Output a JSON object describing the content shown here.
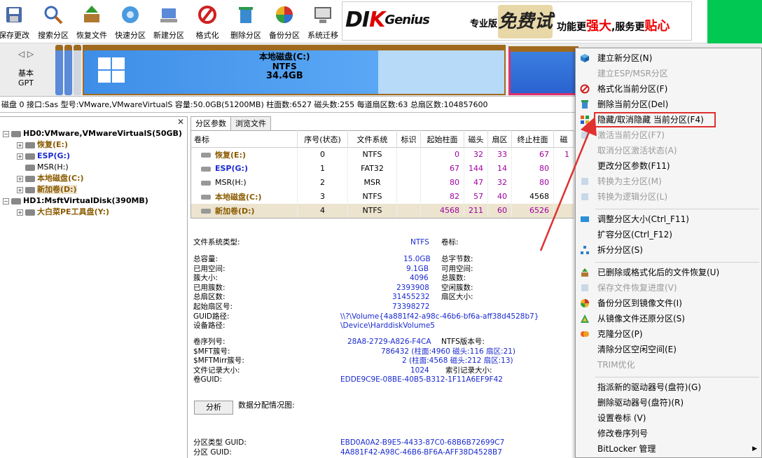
{
  "toolbar": {
    "buttons": [
      {
        "label": "保存更改",
        "icon": "save-icon"
      },
      {
        "label": "搜索分区",
        "icon": "search-icon"
      },
      {
        "label": "恢复文件",
        "icon": "recover-icon"
      },
      {
        "label": "快速分区",
        "icon": "quick-partition-icon"
      },
      {
        "label": "新建分区",
        "icon": "new-partition-icon"
      },
      {
        "label": "格式化",
        "icon": "format-icon"
      },
      {
        "label": "删除分区",
        "icon": "delete-icon"
      },
      {
        "label": "备份分区",
        "icon": "backup-icon"
      },
      {
        "label": "系统迁移",
        "icon": "migrate-icon"
      }
    ]
  },
  "banner": {
    "logo_a": "DI",
    "logo_b": "K",
    "logo_c": "Genius",
    "edition": "专业版",
    "free": "免费试用",
    "slogan_a": "功能更",
    "slogan_b": "强大",
    "slogan_c": ",服务更",
    "slogan_d": "贴心"
  },
  "disk_nav": {
    "type1": "基本",
    "type2": "GPT"
  },
  "main_partition": {
    "name": "本地磁盘(C:)",
    "fs": "NTFS",
    "size": "34.4GB"
  },
  "disk_info": "磁盘 0 接口:Sas  型号:VMware,VMwareVirtualS  容量:50.0GB(51200MB)  柱面数:6527  磁头数:255  每道扇区数:63  总扇区数:104857600",
  "tree": {
    "nodes": [
      {
        "label": "HD0:VMware,VMwareVirtualS(50GB)",
        "color": "#000000"
      },
      {
        "label": "恢复(E:)",
        "color": "#8a5a00"
      },
      {
        "label": "ESP(G:)",
        "color": "#1a2ad0"
      },
      {
        "label": "MSR(H:)",
        "color": "#000000"
      },
      {
        "label": "本地磁盘(C:)",
        "color": "#8a5a00"
      },
      {
        "label": "新加卷(D:)",
        "color": "#8a5a00"
      },
      {
        "label": "HD1:MsftVirtualDisk(390MB)",
        "color": "#000000"
      },
      {
        "label": "大白菜PE工具盘(Y:)",
        "color": "#8a5a00"
      }
    ]
  },
  "tabs": [
    "分区参数",
    "浏览文件"
  ],
  "partition_table": {
    "headers": [
      "卷标",
      "序号(状态)",
      "文件系统",
      "标识",
      "起始柱面",
      "磁头",
      "扇区",
      "终止柱面",
      "磁"
    ],
    "rows": [
      {
        "name": "恢复(E:)",
        "idx": "0",
        "fs": "NTFS",
        "id": "",
        "start": "0",
        "head": "32",
        "sector": "33",
        "end": "67",
        "x": "1",
        "color": "#8a5a00"
      },
      {
        "name": "ESP(G:)",
        "idx": "1",
        "fs": "FAT32",
        "id": "",
        "start": "67",
        "head": "144",
        "sector": "14",
        "end": "80",
        "x": "",
        "color": "#1a2ad0"
      },
      {
        "name": "MSR(H:)",
        "idx": "2",
        "fs": "MSR",
        "id": "",
        "start": "80",
        "head": "47",
        "sector": "32",
        "end": "80",
        "x": "",
        "color": "#000000"
      },
      {
        "name": "本地磁盘(C:)",
        "idx": "3",
        "fs": "NTFS",
        "id": "",
        "start": "82",
        "head": "57",
        "sector": "40",
        "end": "4568",
        "x": "",
        "color": "#8a5a00"
      },
      {
        "name": "新加卷(D:)",
        "idx": "4",
        "fs": "NTFS",
        "id": "",
        "start": "4568",
        "head": "211",
        "sector": "60",
        "end": "6526",
        "x": "",
        "color": "#8a5a00"
      }
    ]
  },
  "fs_info": {
    "fs_type_label": "文件系统类型:",
    "fs_type": "NTFS",
    "vol_label_label": "卷标:",
    "total_label": "总容量:",
    "total": "15.0GB",
    "total_bytes_label": "总字节数:",
    "used_label": "已用空间:",
    "used": "9.1GB",
    "free_label": "可用空间:",
    "cluster_label": "簇大小:",
    "cluster": "4096",
    "clusters_label": "总簇数:",
    "used_clusters_label": "已用簇数:",
    "used_clusters": "2393908",
    "free_clusters_label": "空闲簇数:",
    "sectors_label": "总扇区数:",
    "sectors": "31455232",
    "sector_size_label": "扇区大小:",
    "start_sector_label": "起始扇区号:",
    "start_sector": "73398272",
    "guid_path_label": "GUID路径:",
    "guid_path": "\\\\?\\Volume{4a881f42-a98c-46b6-bf6a-aff38d4528b7}",
    "device_path_label": "设备路径:",
    "device_path": "\\Device\\HarddiskVolume5",
    "serial_label": "卷序列号:",
    "serial": "28A8-2729-A826-F4CA",
    "ntfs_ver_label": "NTFS版本号:",
    "mft_label": "$MFT簇号:",
    "mft": "786432 (柱面:4960 磁头:116 扇区:21)",
    "mftmirr_label": "$MFTMirr簇号:",
    "mftmirr": "2 (柱面:4568 磁头:212 扇区:13)",
    "record_label": "文件记录大小:",
    "record": "1024",
    "index_label": "索引记录大小:",
    "vol_guid_label": "卷GUID:",
    "vol_guid": "EDDE9C9E-08BE-40B5-B312-1F11A6EF9F42",
    "analyze": "分析",
    "alloc_label": "数据分配情况图:",
    "ptype_guid_label": "分区类型 GUID:",
    "ptype_guid": "EBD0A0A2-B9E5-4433-87C0-68B6B72699C7",
    "part_guid_label": "分区 GUID:",
    "part_guid": "4A881F42-A98C-46B6-BF6A-AFF38D4528B7"
  },
  "context_menu": {
    "items": [
      {
        "label": "建立新分区(N)",
        "disabled": false,
        "icon": "cube-icon"
      },
      {
        "label": "建立ESP/MSR分区",
        "disabled": true,
        "icon": ""
      },
      {
        "label": "格式化当前分区(F)",
        "disabled": false,
        "icon": "no-entry-icon"
      },
      {
        "label": "删除当前分区(Del)",
        "disabled": false,
        "icon": "trash-icon"
      },
      {
        "label": "隐藏/取消隐藏 当前分区(F4)",
        "disabled": false,
        "icon": "hide-icon"
      },
      {
        "label": "激活当前分区(F7)",
        "disabled": true,
        "icon": "activate-icon"
      },
      {
        "label": "取消分区激活状态(A)",
        "disabled": true,
        "icon": ""
      },
      {
        "label": "更改分区参数(F11)",
        "disabled": false,
        "icon": ""
      },
      {
        "label": "转换为主分区(M)",
        "disabled": true,
        "icon": "convert-primary-icon"
      },
      {
        "label": "转换为逻辑分区(L)",
        "disabled": true,
        "icon": "convert-logical-icon"
      },
      {
        "label": "调整分区大小(Ctrl_F11)",
        "disabled": false,
        "icon": "resize-icon"
      },
      {
        "label": "扩容分区(Ctrl_F12)",
        "disabled": false,
        "icon": "extend-icon"
      },
      {
        "label": "拆分分区(S)",
        "disabled": false,
        "icon": "split-icon"
      },
      {
        "label": "已删除或格式化后的文件恢复(U)",
        "disabled": false,
        "icon": "file-recover-icon"
      },
      {
        "label": "保存文件恢复进度(V)",
        "disabled": true,
        "icon": "save-progress-icon"
      },
      {
        "label": "备份分区到镜像文件(I)",
        "disabled": false,
        "icon": "backup-image-icon"
      },
      {
        "label": "从镜像文件还原分区(S)",
        "disabled": false,
        "icon": "restore-image-icon"
      },
      {
        "label": "克隆分区(P)",
        "disabled": false,
        "icon": "clone-icon"
      },
      {
        "label": "清除分区空闲空间(E)",
        "disabled": false,
        "icon": ""
      },
      {
        "label": "TRIM优化",
        "disabled": true,
        "icon": ""
      },
      {
        "label": "指派新的驱动器号(盘符)(G)",
        "disabled": false,
        "icon": ""
      },
      {
        "label": "删除驱动器号(盘符)(R)",
        "disabled": false,
        "icon": ""
      },
      {
        "label": "设置卷标 (V)",
        "disabled": false,
        "icon": ""
      },
      {
        "label": "修改卷序列号",
        "disabled": false,
        "icon": ""
      },
      {
        "label": "BitLocker 管理",
        "disabled": false,
        "icon": ""
      }
    ]
  },
  "colors": {
    "accent_red": "#e03030",
    "disabled": "#9a9a9a",
    "brand_brown": "#a06a1e",
    "disk_blue": "#3e8ee8"
  }
}
